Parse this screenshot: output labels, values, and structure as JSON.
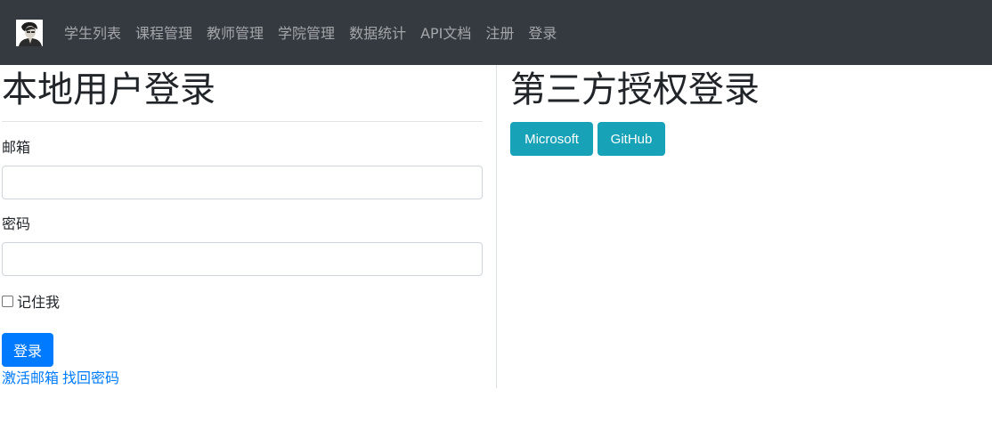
{
  "nav": {
    "items": [
      {
        "label": "学生列表"
      },
      {
        "label": "课程管理"
      },
      {
        "label": "教师管理"
      },
      {
        "label": "学院管理"
      },
      {
        "label": "数据统计"
      },
      {
        "label": "API文档"
      },
      {
        "label": "注册"
      },
      {
        "label": "登录"
      }
    ]
  },
  "local_login": {
    "title": "本地用户登录",
    "email_label": "邮箱",
    "email_value": "",
    "password_label": "密码",
    "password_value": "",
    "remember_label": "记住我",
    "remember_checked": false,
    "submit_label": "登录",
    "links": [
      {
        "label": "激活邮箱"
      },
      {
        "label": "找回密码"
      }
    ]
  },
  "third_party": {
    "title": "第三方授权登录",
    "buttons": [
      {
        "label": "Microsoft"
      },
      {
        "label": "GitHub"
      }
    ]
  },
  "colors": {
    "navbar": "#343a40",
    "primary": "#007bff",
    "info": "#17a2b8"
  }
}
